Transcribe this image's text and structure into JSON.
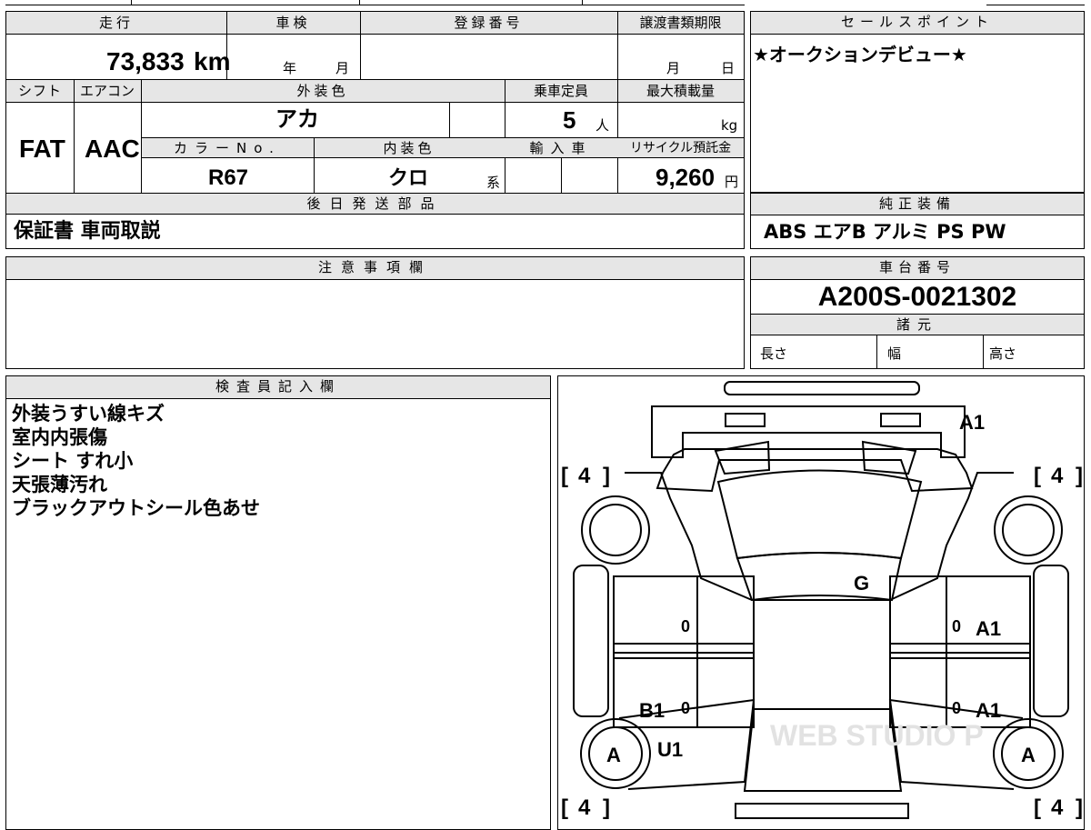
{
  "mileage": {
    "label": "走行",
    "value": "73,833",
    "unit": "km"
  },
  "inspection": {
    "label": "車検",
    "year_unit": "年",
    "month_unit": "月"
  },
  "registration": {
    "label": "登録番号",
    "value": ""
  },
  "transfer_deadline": {
    "label": "譲渡書類期限",
    "month_unit": "月",
    "day_unit": "日"
  },
  "sales_point": {
    "label": "セールスポイント",
    "text": "★オークションデビュー★"
  },
  "shift": {
    "label": "シフト",
    "value": "FAT"
  },
  "aircon": {
    "label": "エアコン",
    "value": "AAC"
  },
  "exterior_color": {
    "label": "外装色",
    "value": "アカ"
  },
  "capacity": {
    "label": "乗車定員",
    "value": "5",
    "unit": "人"
  },
  "max_load": {
    "label": "最大積載量",
    "value": "",
    "unit": "kg"
  },
  "color_no": {
    "label": "カラーNo.",
    "value": "R67"
  },
  "interior_color": {
    "label": "内装色",
    "value": "クロ",
    "unit": "系"
  },
  "import": {
    "label": "輸入車",
    "value": ""
  },
  "recycle": {
    "label": "リサイクル預託金",
    "value": "9,260",
    "unit": "円"
  },
  "later_parts": {
    "label": "後日発送部品",
    "value": "保証書 車両取説"
  },
  "genuine_equipment": {
    "label": "純正装備",
    "value": "ABS エアB アルミ PS PW"
  },
  "notes": {
    "label": "注意事項欄",
    "value": ""
  },
  "chassis": {
    "label": "車台番号",
    "value": "A200S-0021302"
  },
  "specs": {
    "label": "諸元",
    "length": "長さ",
    "width": "幅",
    "height": "高さ"
  },
  "inspector": {
    "label": "検査員記入欄",
    "lines": [
      "外装うすい線キズ",
      "室内内張傷",
      "シート すれ小",
      "天張薄汚れ",
      "ブラックアウトシール色あせ"
    ]
  },
  "diagram": {
    "tread_fl": "4",
    "tread_fr": "4",
    "tread_rl": "4",
    "tread_rr": "4",
    "codes": {
      "front": "A1",
      "windshield": "G",
      "right_front_door": "A1",
      "right_rear_door": "A1",
      "left_rear_door": "B1",
      "left_rear_quarter": "U1",
      "left_rear_wheel": "A",
      "right_rear_wheel": "A",
      "left_front_door_mark": "0",
      "left_rear_door_mark": "0",
      "right_front_door_mark": "0",
      "right_rear_door_mark": "0"
    },
    "watermark": "WEB STUDIO P"
  }
}
